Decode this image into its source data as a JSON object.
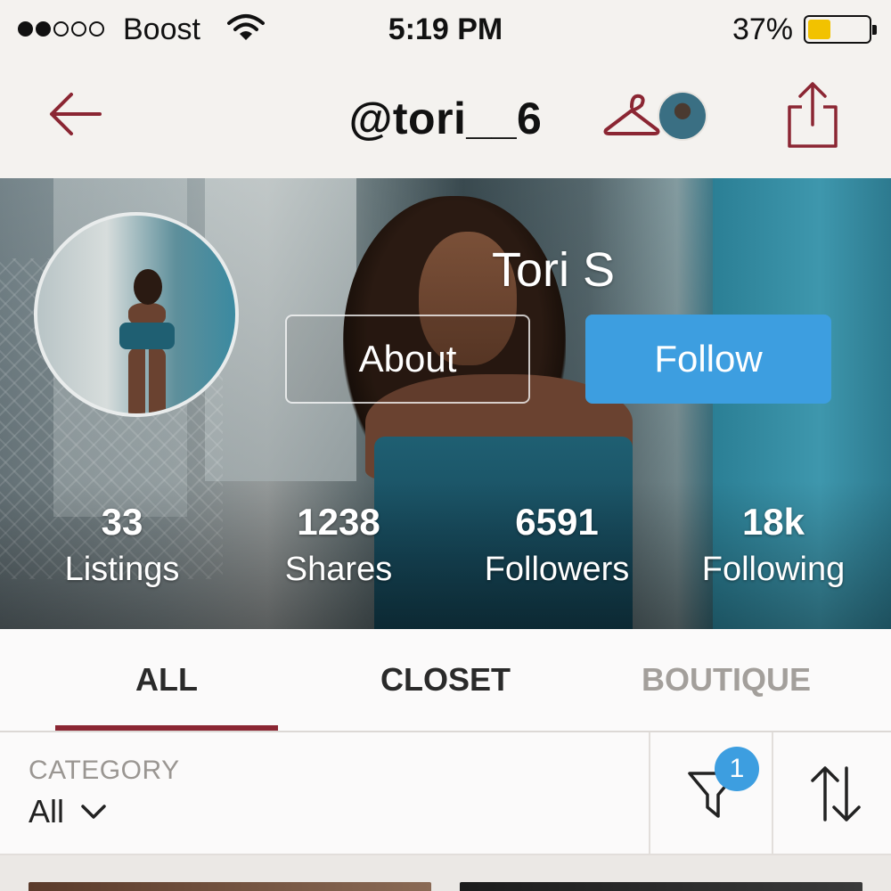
{
  "status_bar": {
    "carrier": "Boost",
    "time": "5:19 PM",
    "battery_percent": "37%",
    "battery_level": 0.37,
    "signal_bars": 2,
    "signal_total": 5
  },
  "nav": {
    "title": "@tori__6",
    "back_icon": "arrow-left-icon",
    "hanger_icon": "hanger-icon",
    "share_icon": "share-icon"
  },
  "profile": {
    "name": "Tori S",
    "about_label": "About",
    "follow_label": "Follow",
    "stats": [
      {
        "value": "33",
        "label": "Listings"
      },
      {
        "value": "1238",
        "label": "Shares"
      },
      {
        "value": "6591",
        "label": "Followers"
      },
      {
        "value": "18k",
        "label": "Following"
      }
    ]
  },
  "tabs": [
    {
      "label": "ALL",
      "active": true
    },
    {
      "label": "CLOSET",
      "active": false
    },
    {
      "label": "BOUTIQUE",
      "active": false
    }
  ],
  "filter": {
    "category_label": "CATEGORY",
    "category_value": "All",
    "filter_badge": "1"
  },
  "colors": {
    "accent_maroon": "#8b2633",
    "follow_blue": "#3d9ee0",
    "battery_yellow": "#f2c200"
  }
}
